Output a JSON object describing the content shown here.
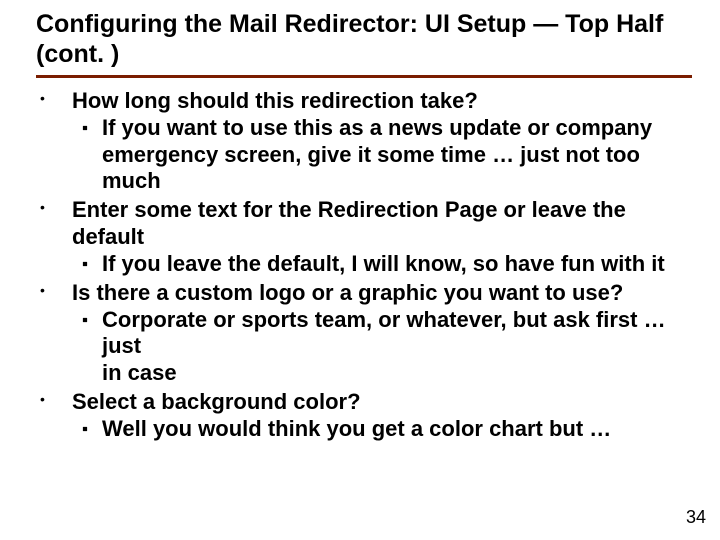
{
  "title": "Configuring the Mail Redirector: UI Setup — Top Half (cont. )",
  "bullets": [
    {
      "text": "How long should this redirection take?",
      "sub": [
        "If you want to use this as a news update or company emergency screen, give it some time … just not too much"
      ]
    },
    {
      "text": "Enter some text for the Redirection Page or leave the default",
      "sub": [
        "If you leave the default, I will know, so have fun with it"
      ]
    },
    {
      "text": "Is there a custom logo or a graphic you want to use?",
      "sub": [
        "Corporate or sports team, or whatever, but ask first … just\nin case"
      ]
    },
    {
      "text": "Select a background color?",
      "sub": [
        "Well you would think you get a color chart but …"
      ]
    }
  ],
  "page_number": "34"
}
